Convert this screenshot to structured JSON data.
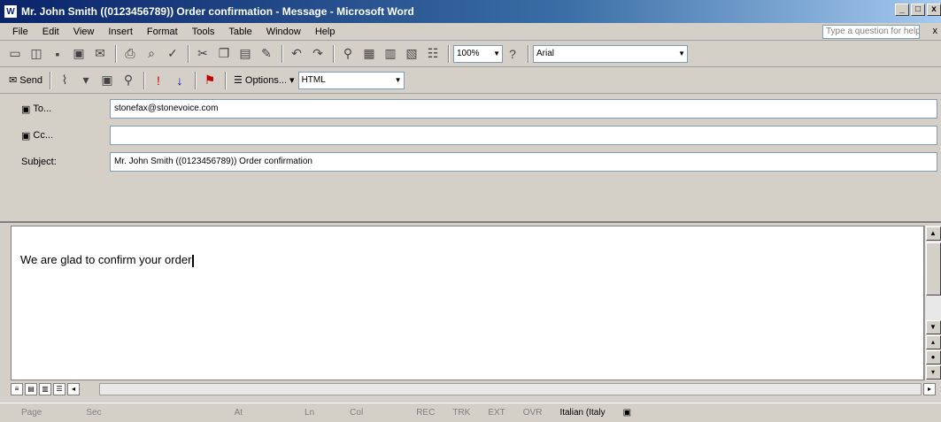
{
  "window": {
    "title": "Mr. John Smith ((0123456789)) Order confirmation - Message - Microsoft Word",
    "minimize": "_",
    "maximize": "□",
    "close": "x"
  },
  "menu": [
    "File",
    "Edit",
    "View",
    "Insert",
    "Format",
    "Tools",
    "Table",
    "Window",
    "Help"
  ],
  "help": {
    "placeholder": "Type a question for help",
    "close": "x"
  },
  "toolbar1": {
    "zoom": "100%",
    "font": "Arial"
  },
  "toolbar2": {
    "send": "Send",
    "options": "Options...",
    "format": "HTML"
  },
  "header": {
    "to_label": "To...",
    "to_value": "stonefax@stonevoice.com",
    "cc_label": "Cc...",
    "cc_value": "",
    "subject_label": "Subject:",
    "subject_value": "Mr. John Smith ((0123456789)) Order confirmation"
  },
  "body": {
    "text": "We are glad to confirm your order"
  },
  "status": {
    "page": "Page",
    "sec": "Sec",
    "at": "At",
    "ln": "Ln",
    "col": "Col",
    "rec": "REC",
    "trk": "TRK",
    "ext": "EXT",
    "ovr": "OVR",
    "lang": "Italian (Italy"
  }
}
